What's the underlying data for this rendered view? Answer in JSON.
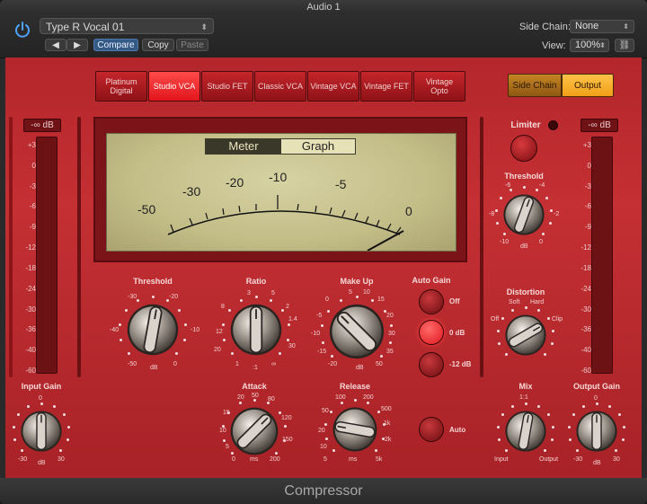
{
  "window": {
    "title": "Audio 1"
  },
  "header": {
    "preset": "Type R Vocal 01",
    "compare": "Compare",
    "copy": "Copy",
    "paste": "Paste",
    "side_chain_label": "Side Chain:",
    "side_chain_value": "None",
    "view_label": "View:",
    "view_value": "100%"
  },
  "models": [
    "Platinum Digital",
    "Studio VCA",
    "Studio FET",
    "Classic VCA",
    "Vintage VCA",
    "Vintage FET",
    "Vintage Opto"
  ],
  "selected_model": "Studio VCA",
  "listen": {
    "side_chain": "Side Chain",
    "output": "Output",
    "active": "Output"
  },
  "input_meter": {
    "readout": "-∞ dB"
  },
  "output_meter": {
    "readout": "-∞ dB"
  },
  "meter_scale": [
    "+3",
    "0",
    "-3",
    "-6",
    "-9",
    "-12",
    "-18",
    "-24",
    "-30",
    "-36",
    "-40",
    "-60"
  ],
  "vu": {
    "tabs": [
      "Meter",
      "Graph"
    ],
    "active_tab": "Meter",
    "scale": [
      "-50",
      "-30",
      "-20",
      "-10",
      "-5",
      "0"
    ],
    "needle_value": "0"
  },
  "controls": {
    "threshold": {
      "label": "Threshold",
      "ticks": [
        "-30",
        "-20",
        "-40",
        "-10",
        "-50",
        "dB",
        "0"
      ]
    },
    "ratio": {
      "label": "Ratio",
      "ticks": [
        "3",
        "5",
        "8",
        "2",
        "12",
        "1.4",
        "20",
        "30",
        "1",
        ":1",
        "∞"
      ]
    },
    "makeup": {
      "label": "Make Up",
      "ticks": [
        "5",
        "10",
        "0",
        "15",
        "-5",
        "20",
        "-10",
        "30",
        "-15",
        "35",
        "-20",
        "dB",
        "50"
      ]
    },
    "auto_gain": {
      "label": "Auto Gain",
      "options": [
        "Off",
        "0 dB",
        "-12 dB"
      ],
      "selected": "0 dB"
    },
    "attack": {
      "label": "Attack",
      "ticks": [
        "20",
        "50",
        "80",
        "15",
        "120",
        "10",
        "150",
        "5",
        "0",
        "ms",
        "200"
      ]
    },
    "release": {
      "label": "Release",
      "ticks": [
        "100",
        "200",
        "50",
        "500",
        "20",
        "1k",
        "10",
        "2k",
        "5",
        "ms",
        "5k"
      ],
      "auto": "Auto"
    },
    "input_gain": {
      "label": "Input Gain",
      "ticks": [
        "0",
        "-30",
        "dB",
        "30"
      ]
    },
    "limiter": {
      "label": "Limiter"
    },
    "limiter_threshold": {
      "label": "Threshold",
      "ticks": [
        "-6",
        "-4",
        "-8",
        "-2",
        "-10",
        "0",
        "dB"
      ]
    },
    "distortion": {
      "label": "Distortion",
      "ticks": [
        "Soft",
        "Hard",
        "Off",
        "Clip"
      ]
    },
    "mix": {
      "label": "Mix",
      "ticks": [
        "1:1",
        "Input",
        "Output"
      ]
    },
    "output_gain": {
      "label": "Output Gain",
      "ticks": [
        "0",
        "-30",
        "dB",
        "30"
      ]
    }
  },
  "footer": {
    "name": "Compressor"
  },
  "colors": {
    "body_red": "#c43034",
    "selected_model": "#ff2a2a",
    "output_orange": "#f2a11c",
    "vu_face": "#c8c290"
  }
}
